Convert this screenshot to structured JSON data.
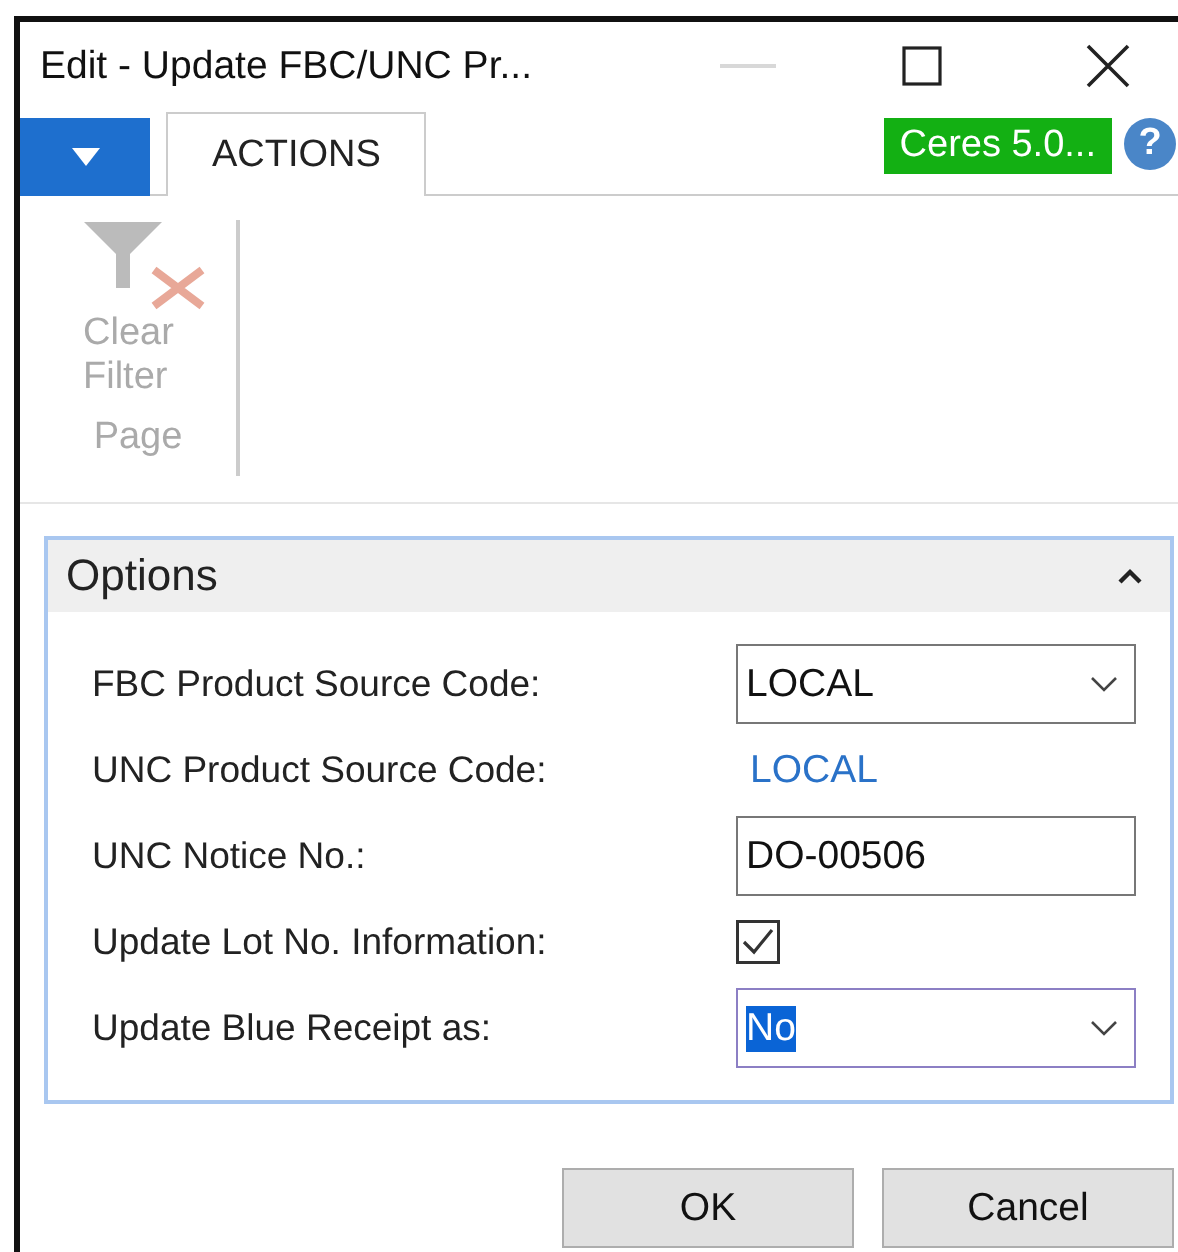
{
  "window": {
    "title": "Edit - Update FBC/UNC Pr...",
    "minimize_disabled": true
  },
  "ribbon": {
    "tabs": [
      {
        "label": "ACTIONS",
        "selected": true
      }
    ],
    "badge": "Ceres 5.0...",
    "help": "?",
    "groups": [
      {
        "label": "Page",
        "actions": [
          {
            "label": "Clear Filter",
            "disabled": true
          }
        ]
      }
    ]
  },
  "options": {
    "title": "Options",
    "expanded": true,
    "fields": [
      {
        "kind": "dropdown",
        "label": "FBC Product Source Code:",
        "value": "LOCAL",
        "focused": false,
        "value_selected": false
      },
      {
        "kind": "link",
        "label": "UNC Product Source Code:",
        "value": "LOCAL"
      },
      {
        "kind": "text",
        "label": "UNC Notice No.:",
        "value": "DO-00506",
        "focused": false,
        "value_selected": false
      },
      {
        "kind": "checkbox",
        "label": "Update Lot No. Information:",
        "checked": true
      },
      {
        "kind": "dropdown",
        "label": "Update Blue Receipt as:",
        "value": "No",
        "focused": true,
        "value_selected": true
      }
    ]
  },
  "buttons": [
    {
      "label": "OK"
    },
    {
      "label": "Cancel"
    }
  ]
}
